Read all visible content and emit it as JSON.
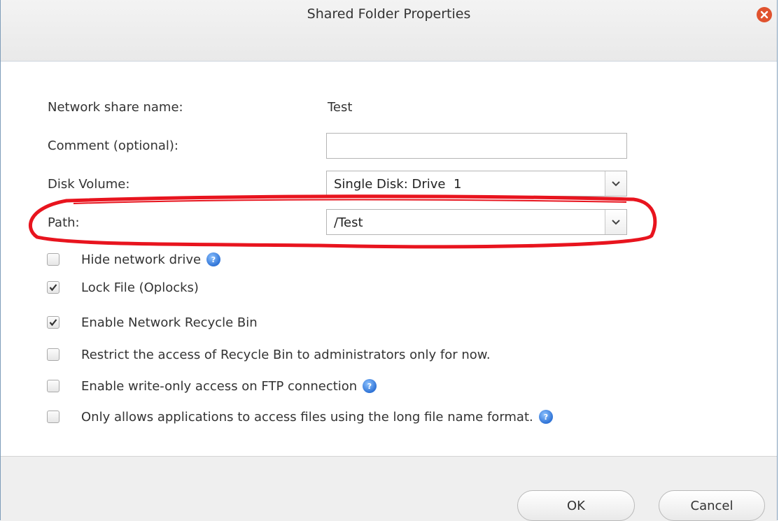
{
  "dialog": {
    "title": "Shared Folder Properties"
  },
  "form": {
    "share_name_label": "Network share name:",
    "share_name_value": "Test",
    "comment_label": "Comment (optional):",
    "comment_value": "",
    "disk_volume_label": "Disk Volume:",
    "disk_volume_value": "Single Disk: Drive  1",
    "path_label": "Path:",
    "path_value": "/Test"
  },
  "options": [
    {
      "label": "Hide network drive",
      "checked": false
    },
    {
      "label": "Lock File (Oplocks)",
      "checked": true
    },
    {
      "label": "Enable Network Recycle Bin",
      "checked": true
    },
    {
      "label": "Restrict the access of Recycle Bin to administrators only for now.",
      "checked": false
    },
    {
      "label": "Enable write-only access on FTP connection",
      "checked": false
    },
    {
      "label": "Only allows applications to access files using the long file name format.",
      "checked": false
    }
  ],
  "buttons": {
    "ok": "OK",
    "cancel": "Cancel"
  },
  "colors": {
    "highlight": "#e8141e",
    "close": "#e0522e",
    "help": "#2f73d6"
  }
}
